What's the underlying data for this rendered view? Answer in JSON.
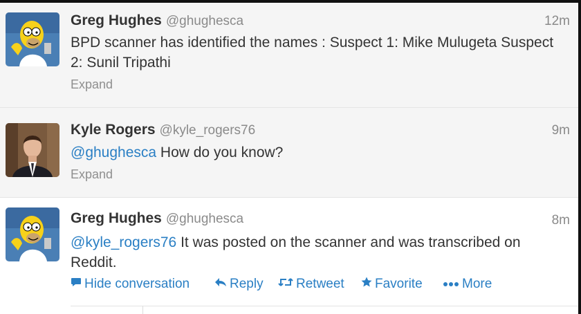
{
  "tweets": [
    {
      "display_name": "Greg Hughes",
      "handle": "@ghughesca",
      "time": "12m",
      "text": "BPD scanner has identified the names : Suspect 1: Mike Mulugeta Suspect 2: Sunil Tripathi",
      "expand_label": "Expand",
      "avatar": "homer-simpson-avatar"
    },
    {
      "display_name": "Kyle Rogers",
      "handle": "@kyle_rogers76",
      "time": "9m",
      "mention": "@ghughesca",
      "text": " How do you know?",
      "expand_label": "Expand",
      "avatar": "man-in-suit-avatar"
    },
    {
      "display_name": "Greg Hughes",
      "handle": "@ghughesca",
      "time": "8m",
      "mention": "@kyle_rogers76",
      "text": " It was posted on the scanner and was transcribed on Reddit.",
      "avatar": "homer-simpson-avatar"
    }
  ],
  "actions": {
    "hide_conversation": "Hide conversation",
    "reply": "Reply",
    "retweet": "Retweet",
    "favorite": "Favorite",
    "more": "More"
  },
  "icons": {
    "hide_conversation": "speech-bubble-icon",
    "reply": "reply-arrow-icon",
    "retweet": "retweet-icon",
    "favorite": "star-icon",
    "more": "ellipsis-icon"
  },
  "colors": {
    "link": "#2a7fc4",
    "text": "#333333",
    "muted": "#8a8a8a",
    "background_collapsed": "#f5f5f5",
    "background_expanded": "#ffffff"
  }
}
